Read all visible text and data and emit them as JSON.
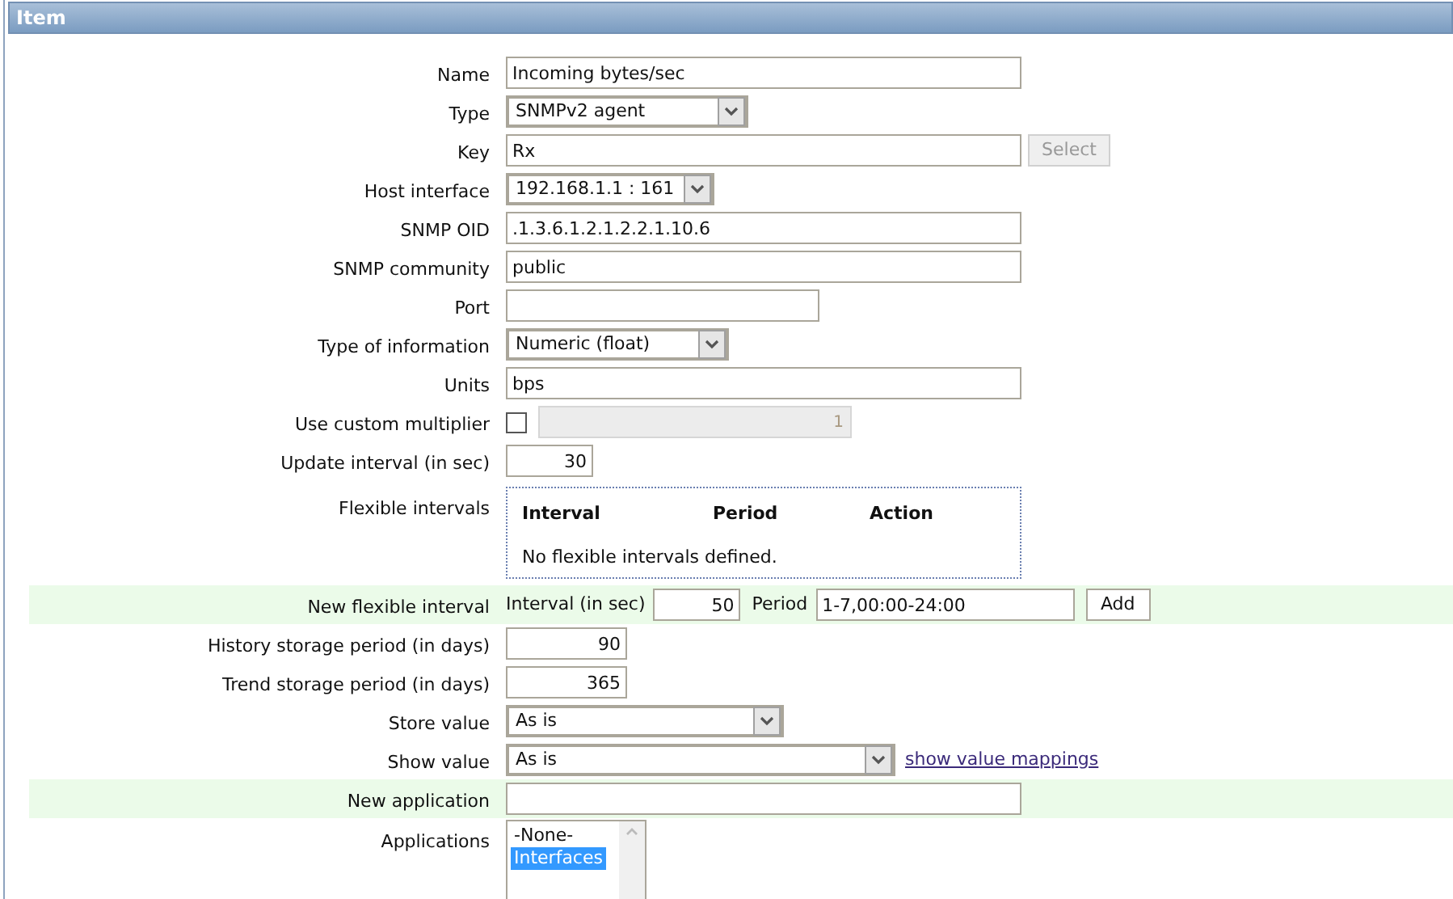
{
  "panel": {
    "title": "Item"
  },
  "rows": [
    {
      "kind": "text",
      "label": "Name",
      "value": "Incoming bytes/sec"
    },
    {
      "kind": "select",
      "label": "Type",
      "value": "SNMPv2 agent"
    },
    {
      "kind": "key",
      "label": "Key",
      "value": "Rx",
      "button": {
        "label": "Select",
        "disabled": true
      }
    },
    {
      "kind": "select",
      "label": "Host interface",
      "value": "192.168.1.1 : 161"
    },
    {
      "kind": "text",
      "label": "SNMP OID",
      "value": ".1.3.6.1.2.1.2.2.1.10.6"
    },
    {
      "kind": "text",
      "label": "SNMP community",
      "value": "public"
    },
    {
      "kind": "text",
      "label": "Port"
    },
    {
      "kind": "select",
      "label": "Type of information",
      "value": "Numeric (float)"
    },
    {
      "kind": "text",
      "label": "Units",
      "value": "bps"
    },
    {
      "kind": "multiplier",
      "label": "Use custom multiplier",
      "checked": false,
      "value": "1",
      "disabled": true
    },
    {
      "kind": "number",
      "label": "Update interval (in sec)",
      "value": "30"
    },
    {
      "kind": "flex_table",
      "label": "Flexible intervals",
      "columns": [
        "Interval",
        "Period",
        "Action"
      ],
      "empty": "No flexible intervals defined."
    },
    {
      "kind": "new_flex",
      "label": "New flexible interval",
      "highlighted": true,
      "interval_label": "Interval (in sec)",
      "interval": "50",
      "period_label": "Period",
      "period": "1-7,00:00-24:00",
      "button": "Add"
    },
    {
      "kind": "number",
      "label": "History storage period (in days)",
      "value": "90"
    },
    {
      "kind": "number",
      "label": "Trend storage period (in days)",
      "value": "365"
    },
    {
      "kind": "select",
      "label": "Store value",
      "value": "As is"
    },
    {
      "kind": "select",
      "label": "Show value",
      "value": "As is",
      "link": "show value mappings"
    },
    {
      "kind": "text",
      "label": "New application",
      "highlighted": true
    },
    {
      "kind": "listbox",
      "label": "Applications",
      "options": [
        {
          "label": "-None-",
          "selected": false
        },
        {
          "label": "Interfaces",
          "selected": true
        }
      ]
    }
  ]
}
